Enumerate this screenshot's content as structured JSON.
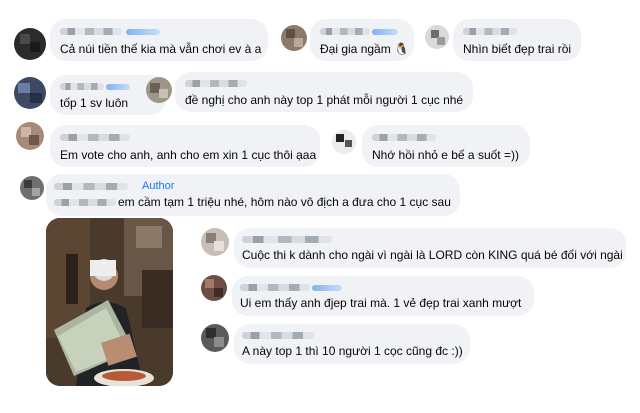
{
  "comments": [
    {
      "text": "Cả núi tiền thế kia mà vẫn chơi ev à a"
    },
    {
      "text": "Đại gia ngầm 🐧"
    },
    {
      "text": "Nhìn biết đẹp trai rồi"
    },
    {
      "text": "tốp 1 sv luôn"
    },
    {
      "text": "đề nghị cho anh này top 1 phát mỗi người 1 cục nhé"
    },
    {
      "text": "Em vote cho anh, anh cho em xin 1 cục thôi ạaa"
    },
    {
      "text": "Nhớ hồi nhỏ e bế a suốt =))"
    },
    {
      "text": "em cầm tạm 1 triệu nhé, hôm nào vô địch a đưa cho 1 cục sau",
      "badge": "Author"
    },
    {
      "text": "Cuộc thi k dành cho ngài vì ngài là LORD còn KING quá bé đối với ngài"
    },
    {
      "text": "Ui em thấy anh đjep trai mà. 1 vẻ đẹp trai xanh mượt"
    },
    {
      "text": "A này top 1 thì 10 người 1 cọc cũng đc :))"
    }
  ],
  "attachment": {
    "kind": "photo"
  }
}
